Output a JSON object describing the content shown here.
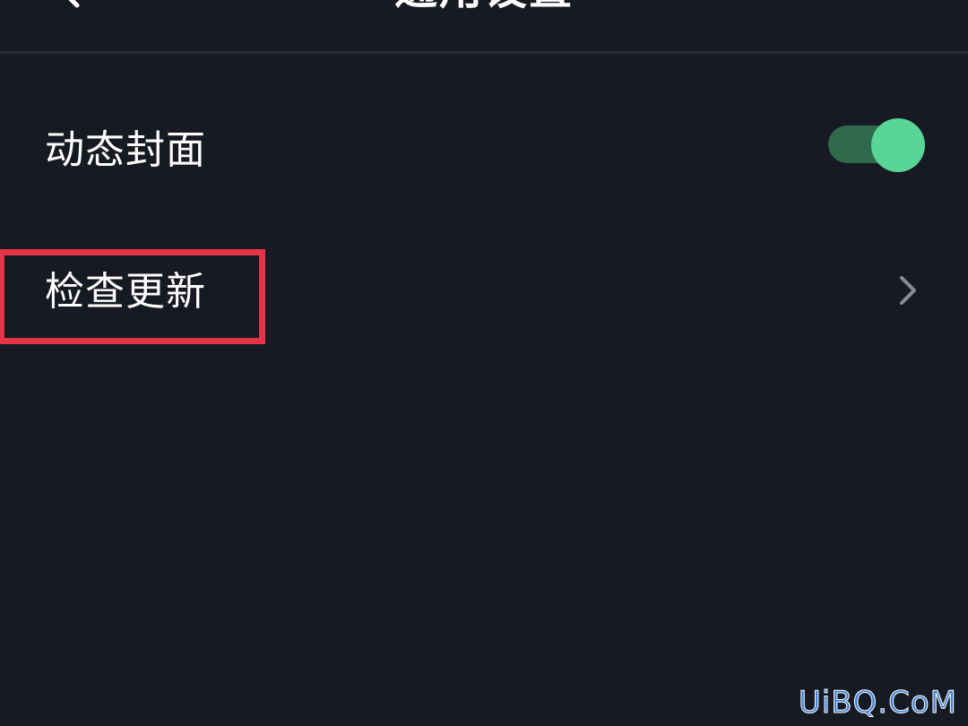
{
  "header": {
    "title": "通用设置",
    "back_icon": "chevron-left-icon"
  },
  "settings": {
    "dynamic_cover": {
      "label": "动态封面",
      "toggle_on": true,
      "toggle_color": "#59d695"
    },
    "check_update": {
      "label": "检查更新",
      "icon": "chevron-right-icon"
    }
  },
  "annotation": {
    "highlight_color": "#e43446"
  },
  "watermark": {
    "text": "UiBQ.CoM"
  },
  "colors": {
    "background": "#171923",
    "text": "#ffffff"
  }
}
